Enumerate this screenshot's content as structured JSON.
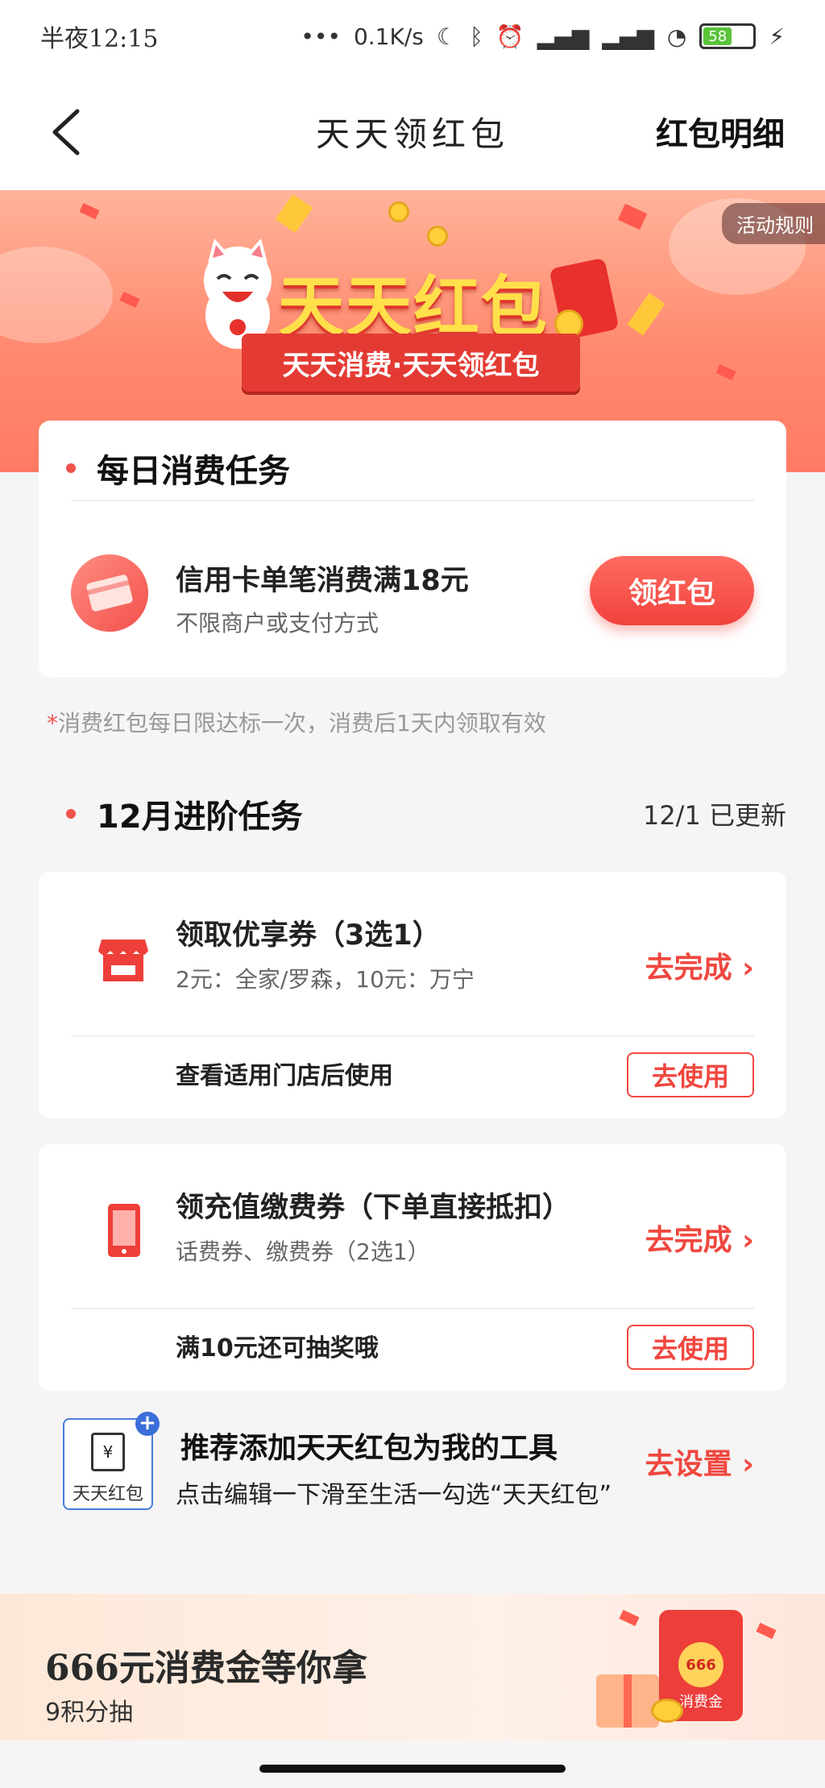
{
  "status_bar": {
    "time": "半夜12:15",
    "net_speed": "0.1K/s",
    "battery": "58"
  },
  "nav": {
    "title": "天天领红包",
    "right_link": "红包明细"
  },
  "hero": {
    "rules_label": "活动规则",
    "title": "天天红包",
    "ribbon": "天天消费·天天领红包"
  },
  "daily": {
    "section_title": "每日消费任务",
    "task_title": "信用卡单笔消费满18元",
    "task_sub": "不限商户或支付方式",
    "button": "领红包",
    "note_star": "*",
    "note": "消费红包每日限达标一次，消费后1天内领取有效"
  },
  "monthly": {
    "section_title": "12月进阶任务",
    "updated": "12/1 已更新",
    "tasks": [
      {
        "title": "领取优享券（3选1）",
        "sub": "2元：全家/罗森，10元：万宁",
        "go": "去完成",
        "foot": "查看适用门店后使用",
        "use": "去使用"
      },
      {
        "title": "领充值缴费券（下单直接抵扣）",
        "sub": "话费券、缴费券（2选1）",
        "go": "去完成",
        "foot": "满10元还可抽奖哦",
        "use": "去使用"
      }
    ]
  },
  "tool": {
    "icon_label": "天天红包",
    "title": "推荐添加天天红包为我的工具",
    "sub": "点击编辑一下滑至生活一勾选“天天红包”",
    "go": "去设置"
  },
  "promo": {
    "title": "666元消费金等你拿",
    "sub": "9积分抽",
    "pack_amount": "666",
    "pack_caption": "消费金"
  },
  "colors": {
    "accent": "#f0473f",
    "hero_top": "#ffb39a",
    "hero_bottom": "#ff7a63",
    "gold": "#ffe04a"
  }
}
